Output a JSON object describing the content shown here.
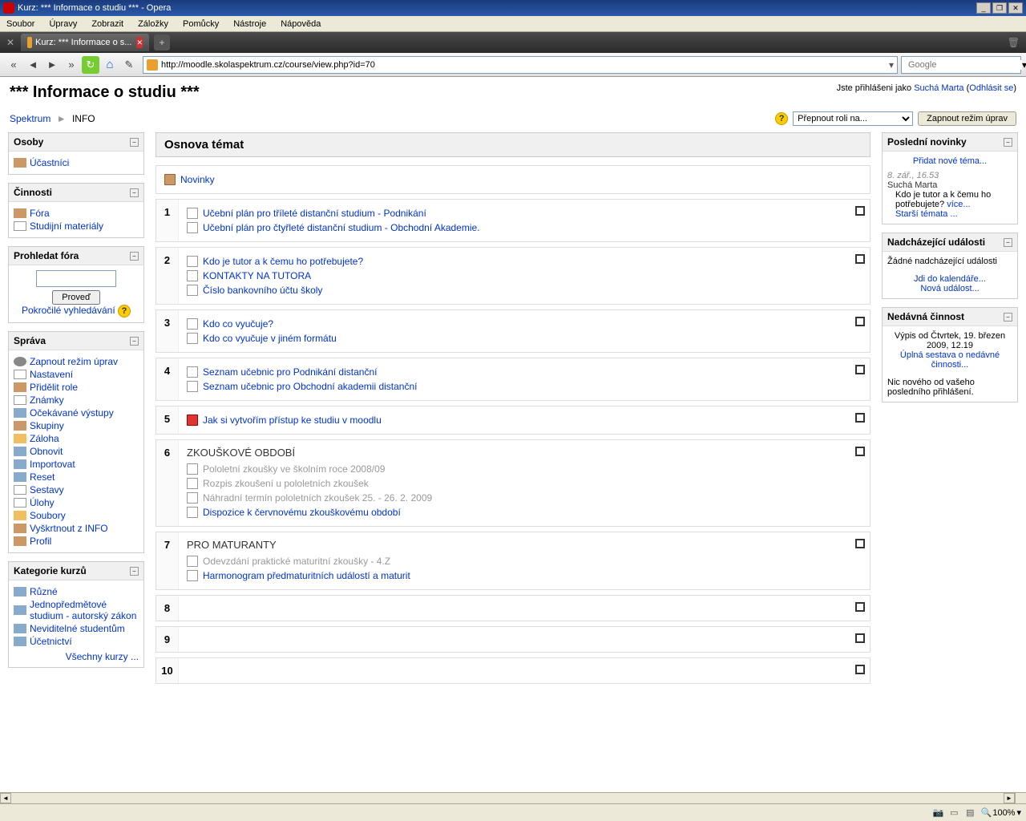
{
  "window": {
    "title": "Kurz: *** Informace o studiu *** - Opera"
  },
  "menubar": [
    "Soubor",
    "Úpravy",
    "Zobrazit",
    "Záložky",
    "Pomůcky",
    "Nástroje",
    "Nápověda"
  ],
  "tab": {
    "title": "Kurz: *** Informace o s..."
  },
  "address": "http://moodle.skolaspektrum.cz/course/view.php?id=70",
  "search_placeholder": "Google",
  "page": {
    "title": "*** Informace o studiu ***",
    "login_prefix": "Jste přihlášeni jako ",
    "login_user": "Suchá Marta",
    "logout": "Odhlásit se"
  },
  "breadcrumb": {
    "root": "Spektrum",
    "current": "INFO"
  },
  "controls": {
    "role_label": "Přepnout roli na...",
    "edit_button": "Zapnout režim úprav"
  },
  "blocks": {
    "osoby": {
      "title": "Osoby",
      "items": [
        "Účastníci"
      ]
    },
    "cinnosti": {
      "title": "Činnosti",
      "items": [
        "Fóra",
        "Studijní materiály"
      ]
    },
    "prohledat": {
      "title": "Prohledat fóra",
      "button": "Proveď",
      "advanced": "Pokročilé vyhledávání"
    },
    "sprava": {
      "title": "Správa",
      "items": [
        "Zapnout režim úprav",
        "Nastavení",
        "Přidělit role",
        "Známky",
        "Očekávané výstupy",
        "Skupiny",
        "Záloha",
        "Obnovit",
        "Importovat",
        "Reset",
        "Sestavy",
        "Úlohy",
        "Soubory",
        "Vyškrtnout z INFO",
        "Profil"
      ]
    },
    "kategorie": {
      "title": "Kategorie kurzů",
      "items": [
        "Různé",
        "Jednopředmětové studium - autorský zákon",
        "Neviditelné studentům",
        "Účetnictví"
      ],
      "all": "Všechny kurzy ..."
    },
    "novinky": {
      "title": "Poslední novinky",
      "add": "Přidat nové téma...",
      "date": "8. zář., 16.53",
      "author": "Suchá Marta",
      "text": "Kdo je tutor a k čemu ho potřebujete? ",
      "more": "více...",
      "older": "Starší témata ..."
    },
    "udalosti": {
      "title": "Nadcházející události",
      "none": "Žádné nadcházející události",
      "calendar": "Jdi do kalendáře...",
      "new_event": "Nová událost..."
    },
    "cinnost": {
      "title": "Nedávná činnost",
      "since": "Výpis od Čtvrtek, 19. březen 2009, 12.19",
      "full": "Úplná sestava o nedávné činnosti...",
      "nothing": "Nic nového od vašeho posledního přihlášení."
    }
  },
  "topics": {
    "header": "Osnova témat",
    "t0": {
      "items": [
        {
          "label": "Novinky",
          "type": "forum"
        }
      ]
    },
    "t1": {
      "items": [
        {
          "label": "Učební plán pro tříleté distanční studium - Podnikání",
          "type": "doc"
        },
        {
          "label": "Učební plán pro čtyřleté distanční studium - Obchodní Akademie.",
          "type": "doc"
        }
      ]
    },
    "t2": {
      "items": [
        {
          "label": "Kdo je tutor a k čemu ho potřebujete?",
          "type": "doc"
        },
        {
          "label": "KONTAKTY NA TUTORA",
          "type": "doc"
        },
        {
          "label": "Číslo bankovního účtu školy",
          "type": "doc"
        }
      ]
    },
    "t3": {
      "items": [
        {
          "label": "Kdo co vyučuje?",
          "type": "doc"
        },
        {
          "label": "Kdo co vyučuje v jiném formátu",
          "type": "doc"
        }
      ]
    },
    "t4": {
      "items": [
        {
          "label": "Seznam učebnic pro Podnikání distanční",
          "type": "doc"
        },
        {
          "label": "Seznam učebnic pro Obchodní akademii distanční",
          "type": "doc"
        }
      ]
    },
    "t5": {
      "items": [
        {
          "label": "Jak si vytvořím přístup ke studiu v moodlu",
          "type": "pdf"
        }
      ]
    },
    "t6": {
      "title": "ZKOUŠKOVÉ OBDOBÍ",
      "items": [
        {
          "label": "Pololetní zkoušky ve školním roce 2008/09",
          "type": "doc",
          "muted": true
        },
        {
          "label": "Rozpis zkoušení u pololetních zkoušek",
          "type": "doc",
          "muted": true
        },
        {
          "label": "Náhradní termín pololetních zkoušek 25. - 26. 2. 2009",
          "type": "doc",
          "muted": true
        },
        {
          "label": "Dispozice k červnovému zkouškovému období",
          "type": "doc"
        }
      ]
    },
    "t7": {
      "title": "PRO MATURANTY",
      "items": [
        {
          "label": "Odevzdání praktické maturitní zkoušky - 4.Z",
          "type": "doc",
          "muted": true
        },
        {
          "label": "Harmonogram předmaturitních událostí a maturit",
          "type": "doc"
        }
      ]
    }
  },
  "status": {
    "zoom": "100%",
    "zoom_icon": "🔍"
  }
}
